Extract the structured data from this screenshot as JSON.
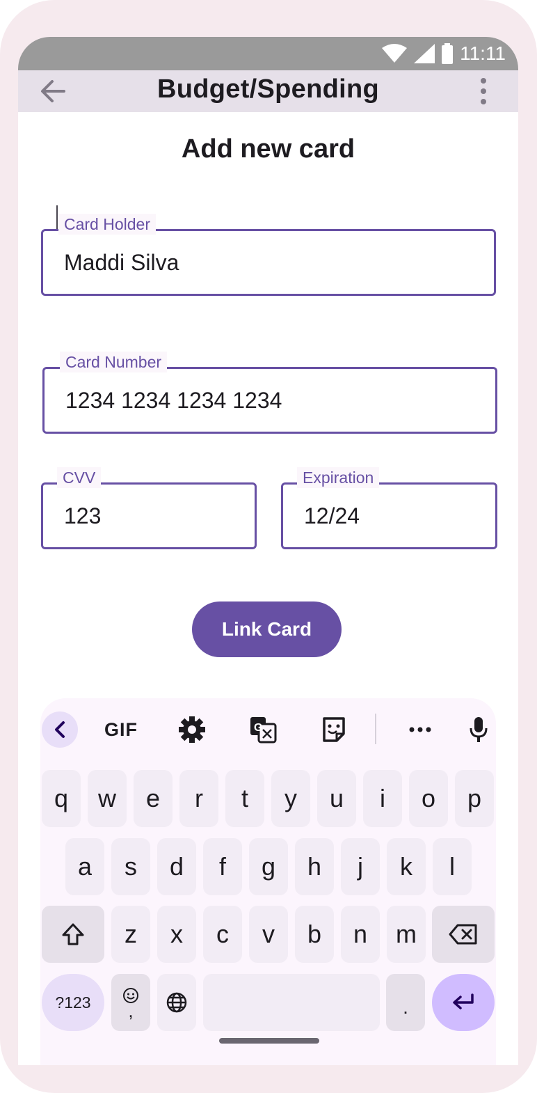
{
  "status_bar": {
    "time": "11:11"
  },
  "app_bar": {
    "title": "Budget/Spending"
  },
  "page": {
    "heading": "Add new card"
  },
  "form": {
    "card_holder": {
      "label": "Card Holder",
      "value": "Maddi Silva"
    },
    "card_number": {
      "label": "Card Number",
      "value": "1234 1234 1234 1234"
    },
    "cvv": {
      "label": "CVV",
      "value": "123"
    },
    "expiration": {
      "label": "Expiration",
      "value": "12/24"
    },
    "submit_label": "Link Card"
  },
  "keyboard": {
    "toolbar": {
      "gif_label": "GIF"
    },
    "row1": [
      "q",
      "w",
      "e",
      "r",
      "t",
      "y",
      "u",
      "i",
      "o",
      "p"
    ],
    "row2": [
      "a",
      "s",
      "d",
      "f",
      "g",
      "h",
      "j",
      "k",
      "l"
    ],
    "row3": [
      "z",
      "x",
      "c",
      "v",
      "b",
      "n",
      "m"
    ],
    "symbols_label": "?123",
    "period_label": ".",
    "comma_label": ","
  },
  "colors": {
    "accent": "#6750a4",
    "app_bar": "#e6e0e9",
    "status_bar": "#9a9a9a",
    "keyboard_bg": "#fcf5fd",
    "enter_key": "#d0bcff"
  }
}
